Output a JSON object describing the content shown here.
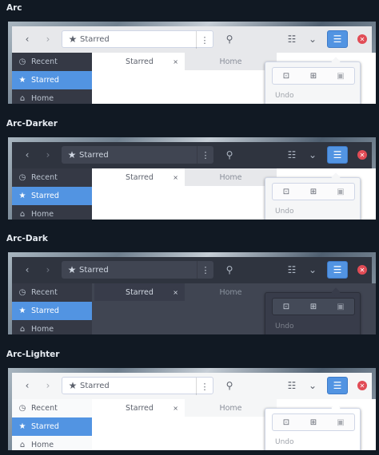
{
  "sections": [
    {
      "title": "Arc"
    },
    {
      "title": "Arc-Darker"
    },
    {
      "title": "Arc-Dark"
    },
    {
      "title": "Arc-Lighter"
    }
  ],
  "window": {
    "path": "Starred",
    "sidebar": [
      "Recent",
      "Starred",
      "Home"
    ],
    "tabs": [
      "Starred",
      "Home"
    ],
    "tab_close": "×",
    "popover_undo": "Undo"
  },
  "icons": {
    "back": "chevron-left-icon",
    "forward": "chevron-right-icon",
    "star": "star-icon",
    "menu": "hamburger-icon",
    "close": "close-icon"
  },
  "colors": {
    "accent": "#5294e2",
    "close": "#e14c56",
    "background": "#111923"
  }
}
